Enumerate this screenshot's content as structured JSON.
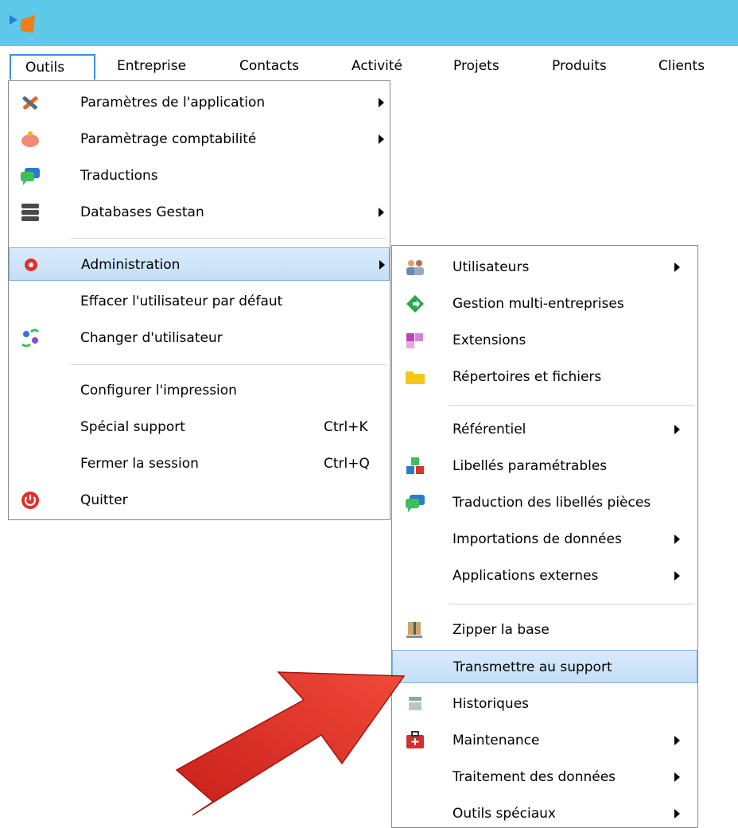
{
  "menubar": {
    "items": [
      {
        "label": "Outils"
      },
      {
        "label": "Entreprise"
      },
      {
        "label": "Contacts"
      },
      {
        "label": "Activité"
      },
      {
        "label": "Projets"
      },
      {
        "label": "Produits"
      },
      {
        "label": "Clients"
      }
    ]
  },
  "outils_menu": {
    "items": [
      {
        "label": "Paramètres de l'application",
        "icon": "tools-icon",
        "submenu": true
      },
      {
        "label": "Paramètrage comptabilité",
        "icon": "piggy-bank-icon",
        "submenu": true
      },
      {
        "label": "Traductions",
        "icon": "chat-bubbles-icon",
        "submenu": false
      },
      {
        "label": "Databases Gestan",
        "icon": "database-icon",
        "submenu": true
      },
      {
        "label": "Administration",
        "icon": "gear-icon",
        "submenu": true,
        "highlighted": true
      },
      {
        "label": "Effacer l'utilisateur par défaut",
        "submenu": false
      },
      {
        "label": "Changer d'utilisateur",
        "icon": "switch-user-icon",
        "submenu": false
      },
      {
        "label": "Configurer l'impression",
        "submenu": false
      },
      {
        "label": "Spécial support",
        "shortcut": "Ctrl+K"
      },
      {
        "label": "Fermer la session",
        "shortcut": "Ctrl+Q"
      },
      {
        "label": "Quitter",
        "icon": "power-icon"
      }
    ]
  },
  "admin_menu": {
    "items": [
      {
        "label": "Utilisateurs",
        "icon": "users-icon",
        "submenu": true
      },
      {
        "label": "Gestion multi-entreprises",
        "icon": "diamond-arrow-icon"
      },
      {
        "label": "Extensions",
        "icon": "puzzle-icon"
      },
      {
        "label": "Répertoires et fichiers",
        "icon": "folder-icon"
      },
      {
        "label": "Référentiel",
        "submenu": true
      },
      {
        "label": "Libellés paramétrables",
        "icon": "abc-blocks-icon"
      },
      {
        "label": "Traduction des libellés pièces",
        "icon": "chat-bubbles-icon"
      },
      {
        "label": "Importations de données",
        "submenu": true
      },
      {
        "label": "Applications externes",
        "submenu": true
      },
      {
        "label": "Zipper la base",
        "icon": "zip-archive-icon"
      },
      {
        "label": "Transmettre au support",
        "highlighted": true
      },
      {
        "label": "Historiques",
        "icon": "archive-box-icon"
      },
      {
        "label": "Maintenance",
        "icon": "first-aid-kit-icon",
        "submenu": true
      },
      {
        "label": "Traitement des données",
        "submenu": true
      },
      {
        "label": "Outils spéciaux",
        "submenu": true
      }
    ]
  },
  "colors": {
    "titlebar": "#5ec8e8",
    "highlight": "#cfe5fa",
    "highlight_border": "#7fb1e6",
    "pointer_arrow": "#e8302a"
  }
}
